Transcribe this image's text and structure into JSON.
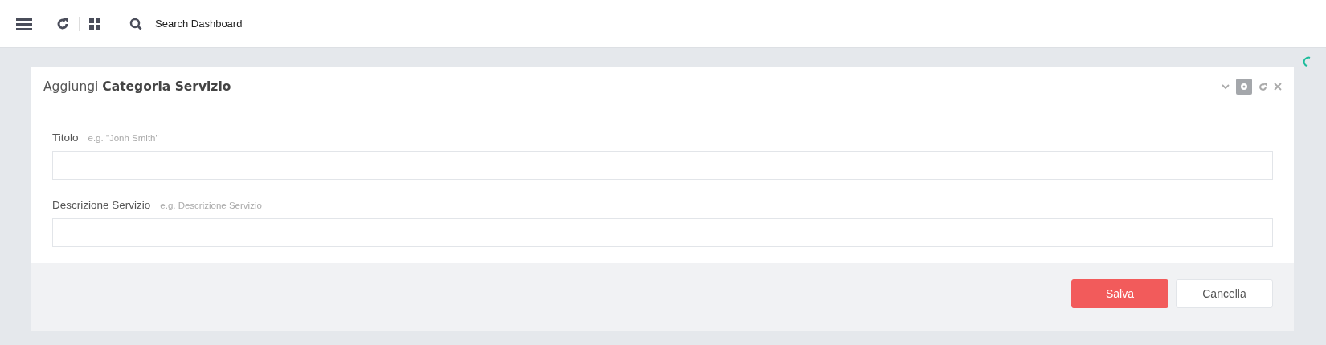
{
  "topbar": {
    "search": {
      "placeholder": "Search Dashboard"
    }
  },
  "panel": {
    "title": "Aggiungi **Categoria Servizio**",
    "fields": [
      {
        "label": "Titolo",
        "hint": "e.g. \"Jonh Smith\""
      },
      {
        "label": "Descrizione Servizio",
        "hint": "e.g. Descrizione Servizio"
      }
    ],
    "buttons": [
      {
        "label": "Salva",
        "kind": "primary"
      },
      {
        "label": "Cancella",
        "kind": "default"
      }
    ]
  }
}
